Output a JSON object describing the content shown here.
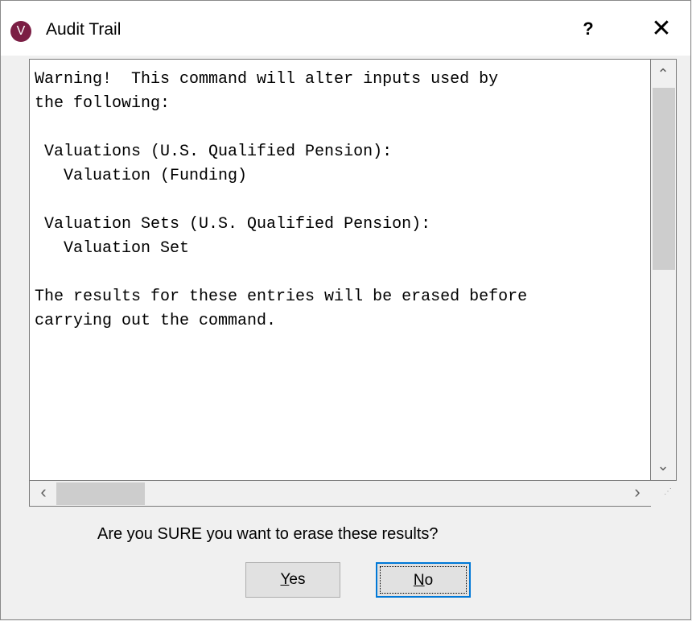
{
  "window": {
    "title": "Audit Trail",
    "app_icon_letter": "V",
    "help_label": "?",
    "close_label": "✕"
  },
  "message": {
    "text": "Warning!  This command will alter inputs used by\nthe following:\n\n Valuations (U.S. Qualified Pension):\n   Valuation (Funding)\n\n Valuation Sets (U.S. Qualified Pension):\n   Valuation Set\n\nThe results for these entries will be erased before\ncarrying out the command."
  },
  "scrollbars": {
    "up_arrow": "⌃",
    "down_arrow": "⌄",
    "left_arrow": "‹",
    "right_arrow": "›",
    "grip": "⋰"
  },
  "prompt": {
    "question": "Are you SURE you want to erase these results?"
  },
  "buttons": {
    "yes": {
      "mnemonic": "Y",
      "rest": "es"
    },
    "no": {
      "mnemonic": "N",
      "rest": "o"
    }
  },
  "colors": {
    "app_icon": "#7b1e44",
    "focus_border": "#0078d7",
    "button_bg": "#e1e1e1",
    "dialog_bg": "#f0f0f0"
  }
}
